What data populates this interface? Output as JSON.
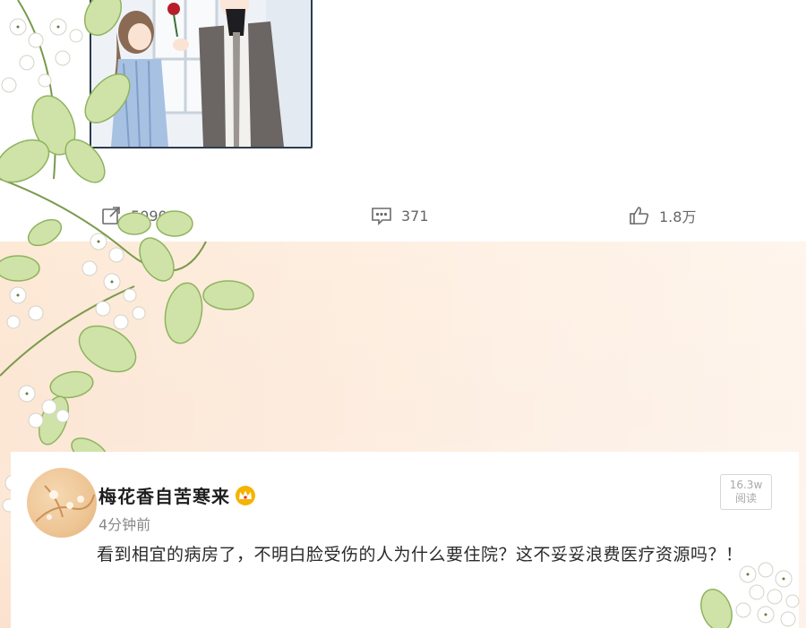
{
  "stats": {
    "share_count": "5090",
    "comment_count": "371",
    "like_count": "1.8万"
  },
  "comment": {
    "username": "梅花香自苦寒来",
    "time": "4分钟前",
    "text": "看到相宜的病房了，不明白脸受伤的人为什么要住院？这不妥妥浪费医疗资源吗？！",
    "read_count": "16.3w",
    "read_label": "阅读"
  },
  "colors": {
    "peach_background": "#fde9d6",
    "badge_gold": "#f4b400",
    "panel_border": "#2d3c4e"
  },
  "icons": {
    "share": "share-icon",
    "comment": "comment-icon",
    "like": "thumbs-up-icon",
    "vip": "crown-icon"
  }
}
